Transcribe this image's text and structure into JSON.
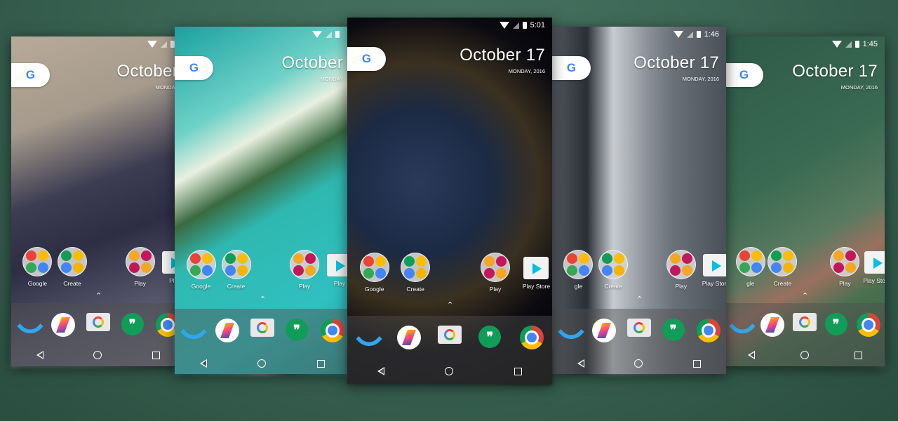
{
  "background_color": "#3b6554",
  "phones": [
    {
      "id": "phone-1",
      "time": "",
      "date": "October",
      "weekday": "MONDAY",
      "wallpaper": "rock-canyon",
      "apps": [
        "Google",
        "Create",
        "Play",
        "Play"
      ]
    },
    {
      "id": "phone-2",
      "time": "",
      "date": "October",
      "weekday": "MONDAY",
      "wallpaper": "turquoise-beach",
      "apps": [
        "Google",
        "Create",
        "Play",
        "Play"
      ]
    },
    {
      "id": "phone-3",
      "time": "5:01",
      "date": "October 17",
      "weekday": "MONDAY, 2016",
      "wallpaper": "earth-night",
      "apps": [
        "Google",
        "Create",
        "Play",
        "Play Store"
      ]
    },
    {
      "id": "phone-4",
      "time": "1:46",
      "date": "October 17",
      "weekday": "MONDAY, 2016",
      "wallpaper": "city-towers",
      "apps": [
        "gle",
        "Create",
        "Play",
        "Play Store"
      ]
    },
    {
      "id": "phone-5",
      "time": "1:45",
      "date": "October 17",
      "weekday": "MONDAY, 2016",
      "wallpaper": "green-fields",
      "apps": [
        "gle",
        "Create",
        "Play",
        "Play Store"
      ]
    }
  ],
  "google_logo": "G",
  "hangouts_glyph": "❞",
  "caret": "⌃",
  "dock_apps": [
    "phone",
    "allo",
    "camera",
    "hangouts",
    "chrome"
  ],
  "nav_buttons": [
    "back",
    "home",
    "recents"
  ]
}
